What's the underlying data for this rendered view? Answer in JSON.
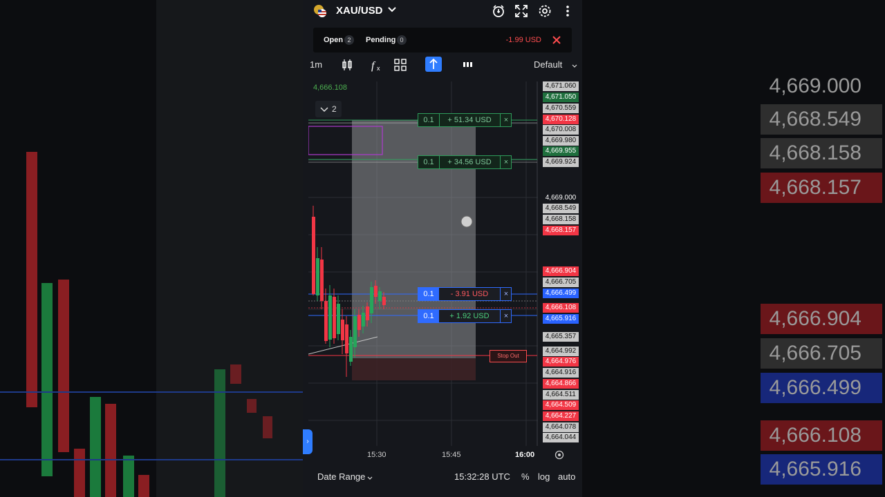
{
  "header": {
    "symbol": "XAU/USD",
    "icons": [
      "alarm-icon",
      "fullscreen-icon",
      "gear-icon",
      "more-icon"
    ]
  },
  "positions": {
    "open_label": "Open",
    "open_count": "2",
    "pending_label": "Pending",
    "pending_count": "0",
    "pnl": "-1.99 USD"
  },
  "toolbar": {
    "timeframe": "1m",
    "layout_label": "Default"
  },
  "chart": {
    "last_price": "4,666.108",
    "collapse_count": "2",
    "orders": [
      {
        "qty": "0.1",
        "pnl": "+ 51.34 USD",
        "close": "×",
        "style": "tp"
      },
      {
        "qty": "0.1",
        "pnl": "+ 34.56 USD",
        "close": "×",
        "style": "tp"
      },
      {
        "qty": "0.1",
        "pnl": "- 3.91 USD",
        "close": "×",
        "style": "open-loss"
      },
      {
        "qty": "0.1",
        "pnl": "+ 1.92 USD",
        "close": "×",
        "style": "open-gain"
      }
    ],
    "stop_out_label": "Stop Out",
    "price_tags": [
      {
        "text": "4,671.060",
        "color": "#c8c8c8"
      },
      {
        "text": "4,671.050",
        "color": "#1f6f3d"
      },
      {
        "text": "4,670.559",
        "color": "#c8c8c8"
      },
      {
        "text": "4,670.128",
        "color": "#f23645"
      },
      {
        "text": "4,670.008",
        "color": "#c8c8c8"
      },
      {
        "text": "4,669.980",
        "color": "#c8c8c8"
      },
      {
        "text": "4,669.955",
        "color": "#1f6f3d"
      },
      {
        "text": "4,669.924",
        "color": "#c8c8c8"
      },
      {
        "text": "4,669.000",
        "color": "none"
      },
      {
        "text": "4,668.549",
        "color": "#c8c8c8"
      },
      {
        "text": "4,668.158",
        "color": "#c8c8c8"
      },
      {
        "text": "4,668.157",
        "color": "#f23645"
      },
      {
        "text": "4,666.904",
        "color": "#f23645"
      },
      {
        "text": "4,666.705",
        "color": "#c8c8c8"
      },
      {
        "text": "4,666.499",
        "color": "#2962ff"
      },
      {
        "text": "4,666.108",
        "color": "#f23645"
      },
      {
        "text": "4,665.916",
        "color": "#2962ff"
      },
      {
        "text": "4,665.357",
        "color": "#c8c8c8"
      },
      {
        "text": "4,664.992",
        "color": "#c8c8c8"
      },
      {
        "text": "4,664.976",
        "color": "#f23645"
      },
      {
        "text": "4,664.916",
        "color": "#c8c8c8"
      },
      {
        "text": "4,664.866",
        "color": "#f23645"
      },
      {
        "text": "4,664.511",
        "color": "#c8c8c8"
      },
      {
        "text": "4,664.509",
        "color": "#f23645"
      },
      {
        "text": "4,664.227",
        "color": "#f23645"
      },
      {
        "text": "4,664.078",
        "color": "#c8c8c8"
      },
      {
        "text": "4,664.044",
        "color": "#c8c8c8"
      }
    ],
    "time_labels": [
      "15:30",
      "15:45",
      "16:00"
    ]
  },
  "bottom": {
    "date_range_label": "Date Range",
    "time": "15:32:28 UTC",
    "percent_label": "%",
    "log_label": "log",
    "auto_label": "auto"
  },
  "background_right_labels": [
    {
      "text": "4,669.000",
      "color": "none"
    },
    {
      "text": "4,668.549",
      "color": "#3a3a3a"
    },
    {
      "text": "4,668.158",
      "color": "#3a3a3a"
    },
    {
      "text": "4,668.157",
      "color": "#7a1a1f"
    },
    {
      "text": "4,666.904",
      "color": "#7a1a1f"
    },
    {
      "text": "4,666.705",
      "color": "#3a3a3a"
    },
    {
      "text": "4,666.499",
      "color": "#1a2f7a"
    },
    {
      "text": "4,666.108",
      "color": "#7a1a1f"
    },
    {
      "text": "4,665.916",
      "color": "#1a2f7a"
    }
  ],
  "colors": {
    "accent": "#2f7dff",
    "up": "#26a65b",
    "down": "#f23645",
    "panel": "#15171c"
  }
}
